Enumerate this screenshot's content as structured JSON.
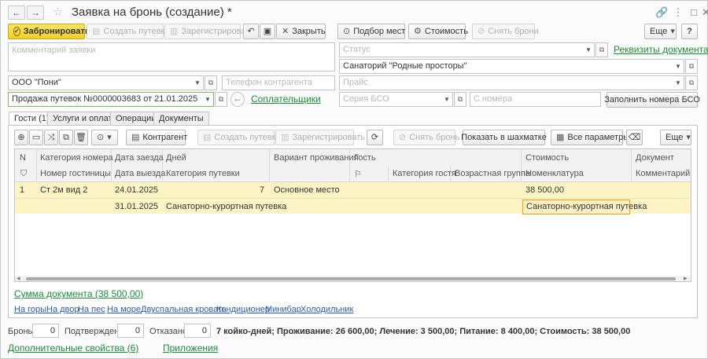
{
  "window": {
    "title": "Заявка на бронь (создание) *",
    "nav_back": "←",
    "nav_forward": "→",
    "favorite_icon": "star-icon",
    "link_icon": "link-icon",
    "menu_icon": "more-icon",
    "maximize_icon": "maximize-icon",
    "close_icon": "close-icon"
  },
  "toolbar": {
    "book": "Забронировать",
    "create_voucher": "Создать путевки",
    "register": "Зарегистрировать",
    "close": "Закрыть",
    "pick_places": "Подбор мест",
    "cost": "Стоимость",
    "remove_booking": "Снять брони",
    "more": "Еще",
    "help": "?"
  },
  "form": {
    "comment_placeholder": "Комментарий заявки",
    "status_placeholder": "Статус",
    "requisites_link": "Реквизиты документа",
    "sanatorium": "Санаторий \"Родные просторы\"",
    "counterparty": "ООО \"Пони\"",
    "phone_placeholder": "Телефон контрагента",
    "price_placeholder": "Прайс",
    "sale": "Продажа путевок №0000003683 от 21.01.2025",
    "copayers_link": "Соплательщики",
    "bso_series_placeholder": "Серия БСО",
    "from_number_placeholder": "С номера",
    "fill_bso": "Заполнить номера БСО"
  },
  "tabs": [
    {
      "label": "Гости (1)",
      "active": true
    },
    {
      "label": "Услуги и оплата",
      "active": false
    },
    {
      "label": "Операции",
      "active": false
    },
    {
      "label": "Документы",
      "active": false
    }
  ],
  "tab_toolbar": {
    "counterparty": "Контрагент",
    "create_voucher": "Создать путевку",
    "register": "Зарегистрировать",
    "remove_booking": "Снять бронь",
    "show_chess": "Показать в шахматке",
    "all_params": "Все параметры",
    "more": "Еще"
  },
  "table": {
    "headers_row1": [
      "N",
      "Категория номера",
      "Дата заезда",
      "Дней",
      "Вариант проживания",
      "Гость",
      "Стоимость",
      "Документ"
    ],
    "headers_row2": [
      "Номер гостиницы",
      "Дата выезда",
      "Категория путевки",
      "Категория гостя",
      "Возрастная группа",
      "Номенклатура",
      "Комментарий"
    ],
    "rows": [
      {
        "n": "1",
        "room_category": "Ст 2м вид 2",
        "arrival": "24.01.2025",
        "days": "7",
        "living": "Основное место",
        "cost": "38 500,00",
        "departure": "31.01.2025",
        "voucher_category": "Санаторно-курортная путевка",
        "nomenclature": "Санаторно-курортная путевка"
      }
    ]
  },
  "summary": {
    "doc_sum_link": "Сумма документа (38 500,00)"
  },
  "filters": [
    "На горы",
    "На двор",
    "На пес",
    "На море",
    "Двуспальная кровать",
    "Кондиционер",
    "Минибар",
    "Холодильник"
  ],
  "bottom": {
    "booking_label": "Бронь:",
    "booking_value": "0",
    "confirmed_label": "Подтверждено:",
    "confirmed_value": "0",
    "refused_label": "Отказано:",
    "refused_value": "0",
    "totals": "7 койко-дней; Проживание: 26 600,00; Лечение: 3 500,00; Питание: 8 400,00; Стоимость: 38 500,00",
    "extra_props_link": "Дополнительные свойства (6)",
    "attachments_link": "Приложения"
  },
  "colors": {
    "accent_yellow": "#f1cf27",
    "link_green": "#1b8e3a",
    "filter_blue": "#2a5db0",
    "row_highlight": "#fdf4c6",
    "selected_border": "#e3a617"
  }
}
